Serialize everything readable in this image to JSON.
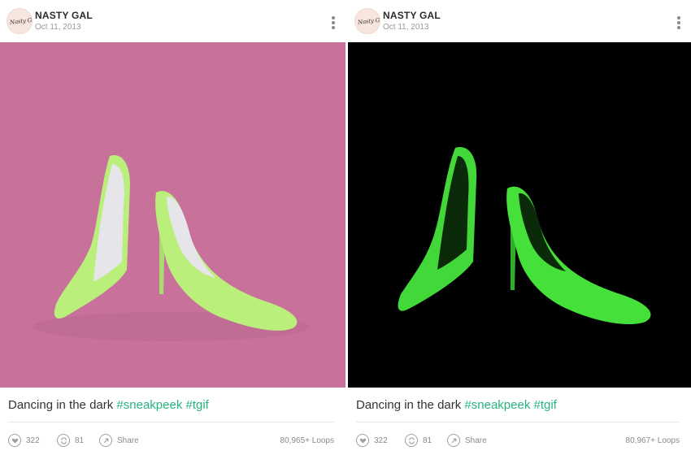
{
  "posts": [
    {
      "user": "NASTY GAL",
      "avatar_text": "Nasty Gal",
      "date": "Oct 11, 2013",
      "caption": "Dancing in the dark",
      "hashtags": [
        "#sneakpeek",
        "#tgif"
      ],
      "likes": "322",
      "revines": "81",
      "share_label": "Share",
      "loops": "80,965+ Loops",
      "background": "#c9729c",
      "shoe_color": "#b9ef7a"
    },
    {
      "user": "NASTY GAL",
      "avatar_text": "Nasty Gal",
      "date": "Oct 11, 2013",
      "caption": "Dancing in the dark",
      "hashtags": [
        "#sneakpeek",
        "#tgif"
      ],
      "likes": "322",
      "revines": "81",
      "share_label": "Share",
      "loops": "80,967+ Loops",
      "background": "#000000",
      "shoe_color": "#45e03a"
    }
  ]
}
